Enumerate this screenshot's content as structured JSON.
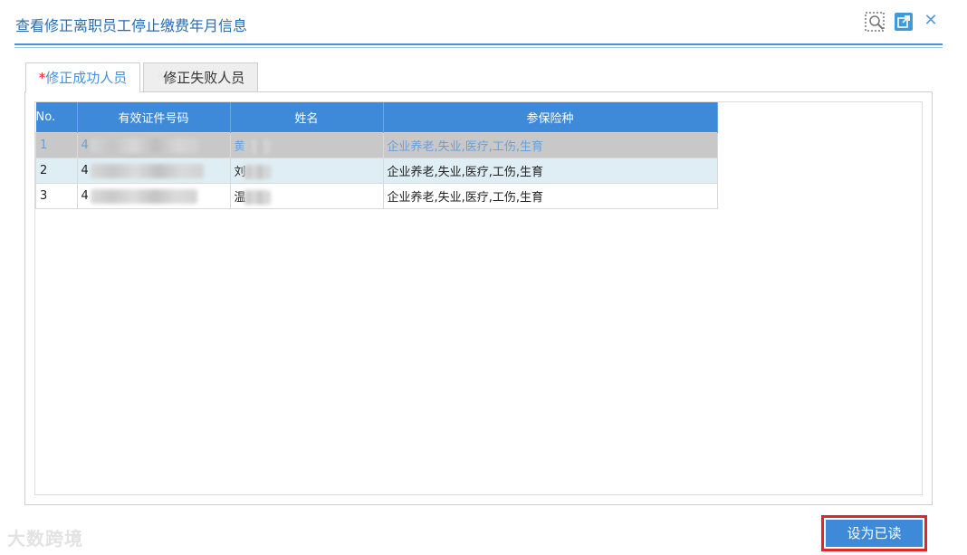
{
  "dialog": {
    "title": "查看修正离职员工停止缴费年月信息",
    "close_glyph": "✕"
  },
  "tabs": [
    {
      "star": "*",
      "label": "修正成功人员",
      "active": true
    },
    {
      "star": "*",
      "label": "修正失败人员",
      "active": false
    }
  ],
  "grid": {
    "columns": [
      "No.",
      "有效证件号码",
      "姓名",
      "参保险种"
    ],
    "rows": [
      {
        "no": "1",
        "id_prefix": "4",
        "name_prefix": "黄",
        "insurance": "企业养老,失业,医疗,工伤,生育"
      },
      {
        "no": "2",
        "id_prefix": "4",
        "name_prefix": "刘",
        "insurance": "企业养老,失业,医疗,工伤,生育"
      },
      {
        "no": "3",
        "id_prefix": "4",
        "name_prefix": "温",
        "insurance": "企业养老,失业,医疗,工伤,生育"
      }
    ]
  },
  "footer": {
    "mark_read_button": "设为已读",
    "watermark": "大数跨境"
  },
  "colors": {
    "accent": "#3f8ad8",
    "highlight_border": "#e0262b"
  },
  "icons": [
    "restore-icon",
    "popout-icon",
    "close-icon"
  ]
}
